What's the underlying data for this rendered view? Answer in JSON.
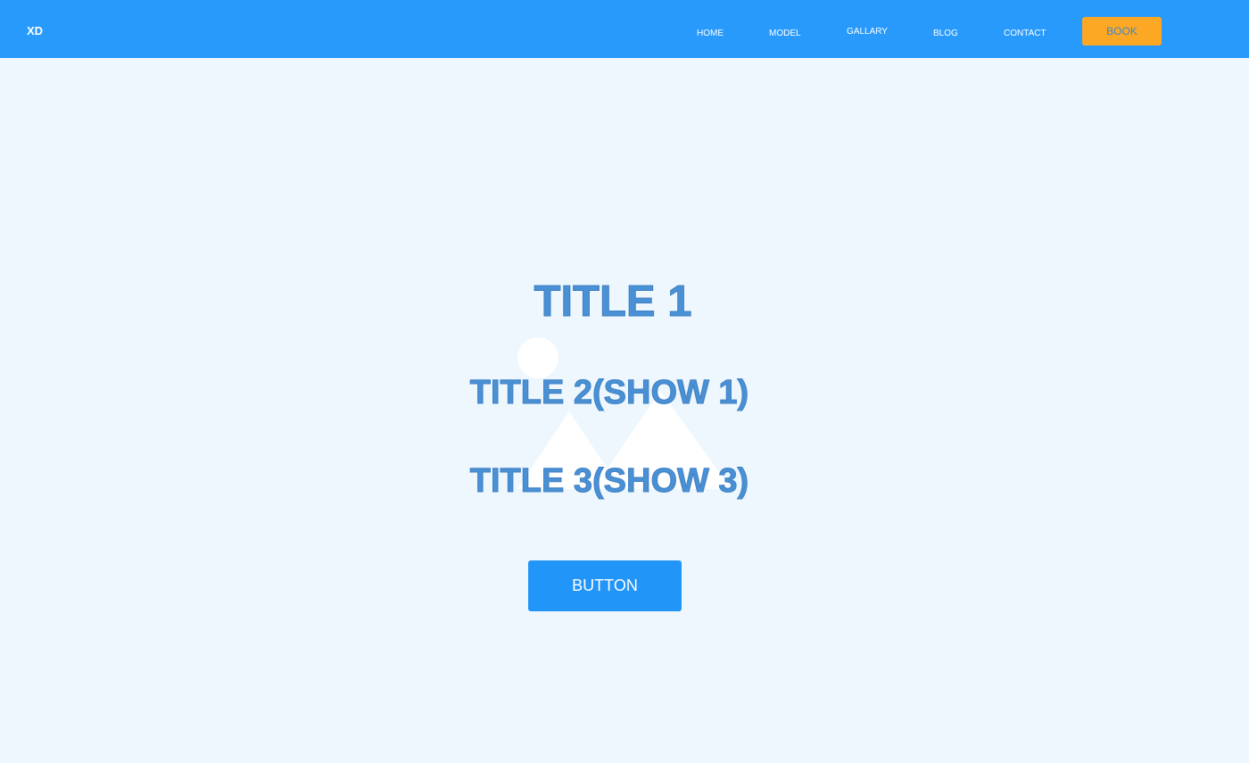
{
  "header": {
    "logo": "XD",
    "nav": [
      {
        "label": "HOME"
      },
      {
        "label": "MODEL"
      },
      {
        "label": "GALLARY"
      },
      {
        "label": "BLOG"
      },
      {
        "label": "CONTACT"
      }
    ],
    "book_label": "BOOK"
  },
  "hero": {
    "image_icon": "image-placeholder-icon",
    "title_1": "TITLE 1",
    "title_2": "TITLE 2(SHOW 1)",
    "title_3": "TITLE 3(SHOW 3)",
    "button_label": "BUTTON"
  },
  "colors": {
    "header_bg": "#289afc",
    "page_bg": "#eef7fd",
    "book_button": "#fda825",
    "primary_button": "#2295f8",
    "title_text": "#4a90d4"
  }
}
